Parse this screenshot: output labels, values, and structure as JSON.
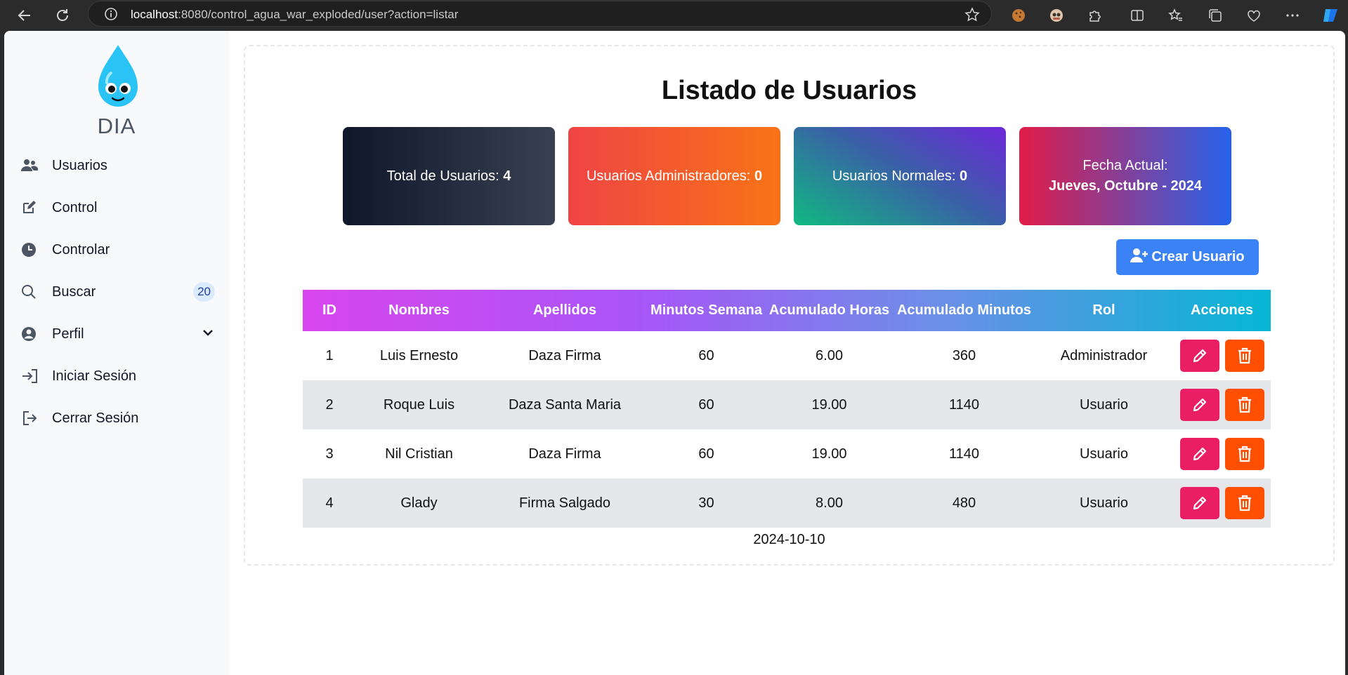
{
  "browser": {
    "url_host": "localhost",
    "url_rest": ":8080/control_agua_war_exploded/user?action=listar"
  },
  "sidebar": {
    "logo_text": "DIA",
    "items": [
      {
        "label": "Usuarios",
        "icon": "users-icon"
      },
      {
        "label": "Control",
        "icon": "edit-icon"
      },
      {
        "label": "Controlar",
        "icon": "clock-icon"
      },
      {
        "label": "Buscar",
        "icon": "search-icon",
        "badge": "20"
      },
      {
        "label": "Perfil",
        "icon": "user-circle-icon"
      },
      {
        "label": "Iniciar Sesión",
        "icon": "login-icon"
      },
      {
        "label": "Cerrar Sesión",
        "icon": "logout-icon"
      }
    ]
  },
  "main": {
    "title": "Listado de Usuarios",
    "cards": {
      "total_label": "Total de Usuarios:",
      "total_value": "4",
      "admins_label": "Usuarios Administradores:",
      "admins_value": "0",
      "normal_label": "Usuarios Normales:",
      "normal_value": "0",
      "date_label": "Fecha Actual:",
      "date_value": "Jueves, Octubre - 2024"
    },
    "create_button": "Crear Usuario",
    "table": {
      "headers": [
        "ID",
        "Nombres",
        "Apellidos",
        "Minutos Semana",
        "Acumulado Horas",
        "Acumulado Minutos",
        "Rol",
        "Acciones"
      ],
      "rows": [
        [
          "1",
          "Luis Ernesto",
          "Daza Firma",
          "60",
          "6.00",
          "360",
          "Administrador"
        ],
        [
          "2",
          "Roque Luis",
          "Daza Santa Maria",
          "60",
          "19.00",
          "1140",
          "Usuario"
        ],
        [
          "3",
          "Nil Cristian",
          "Daza Firma",
          "60",
          "19.00",
          "1140",
          "Usuario"
        ],
        [
          "4",
          "Glady",
          "Firma Salgado",
          "30",
          "8.00",
          "480",
          "Usuario"
        ]
      ]
    },
    "footer_date": "2024-10-10"
  },
  "colors": {
    "edit_button": "#e91e63",
    "delete_button": "#ff4f00",
    "create_button": "#3b82f6"
  }
}
